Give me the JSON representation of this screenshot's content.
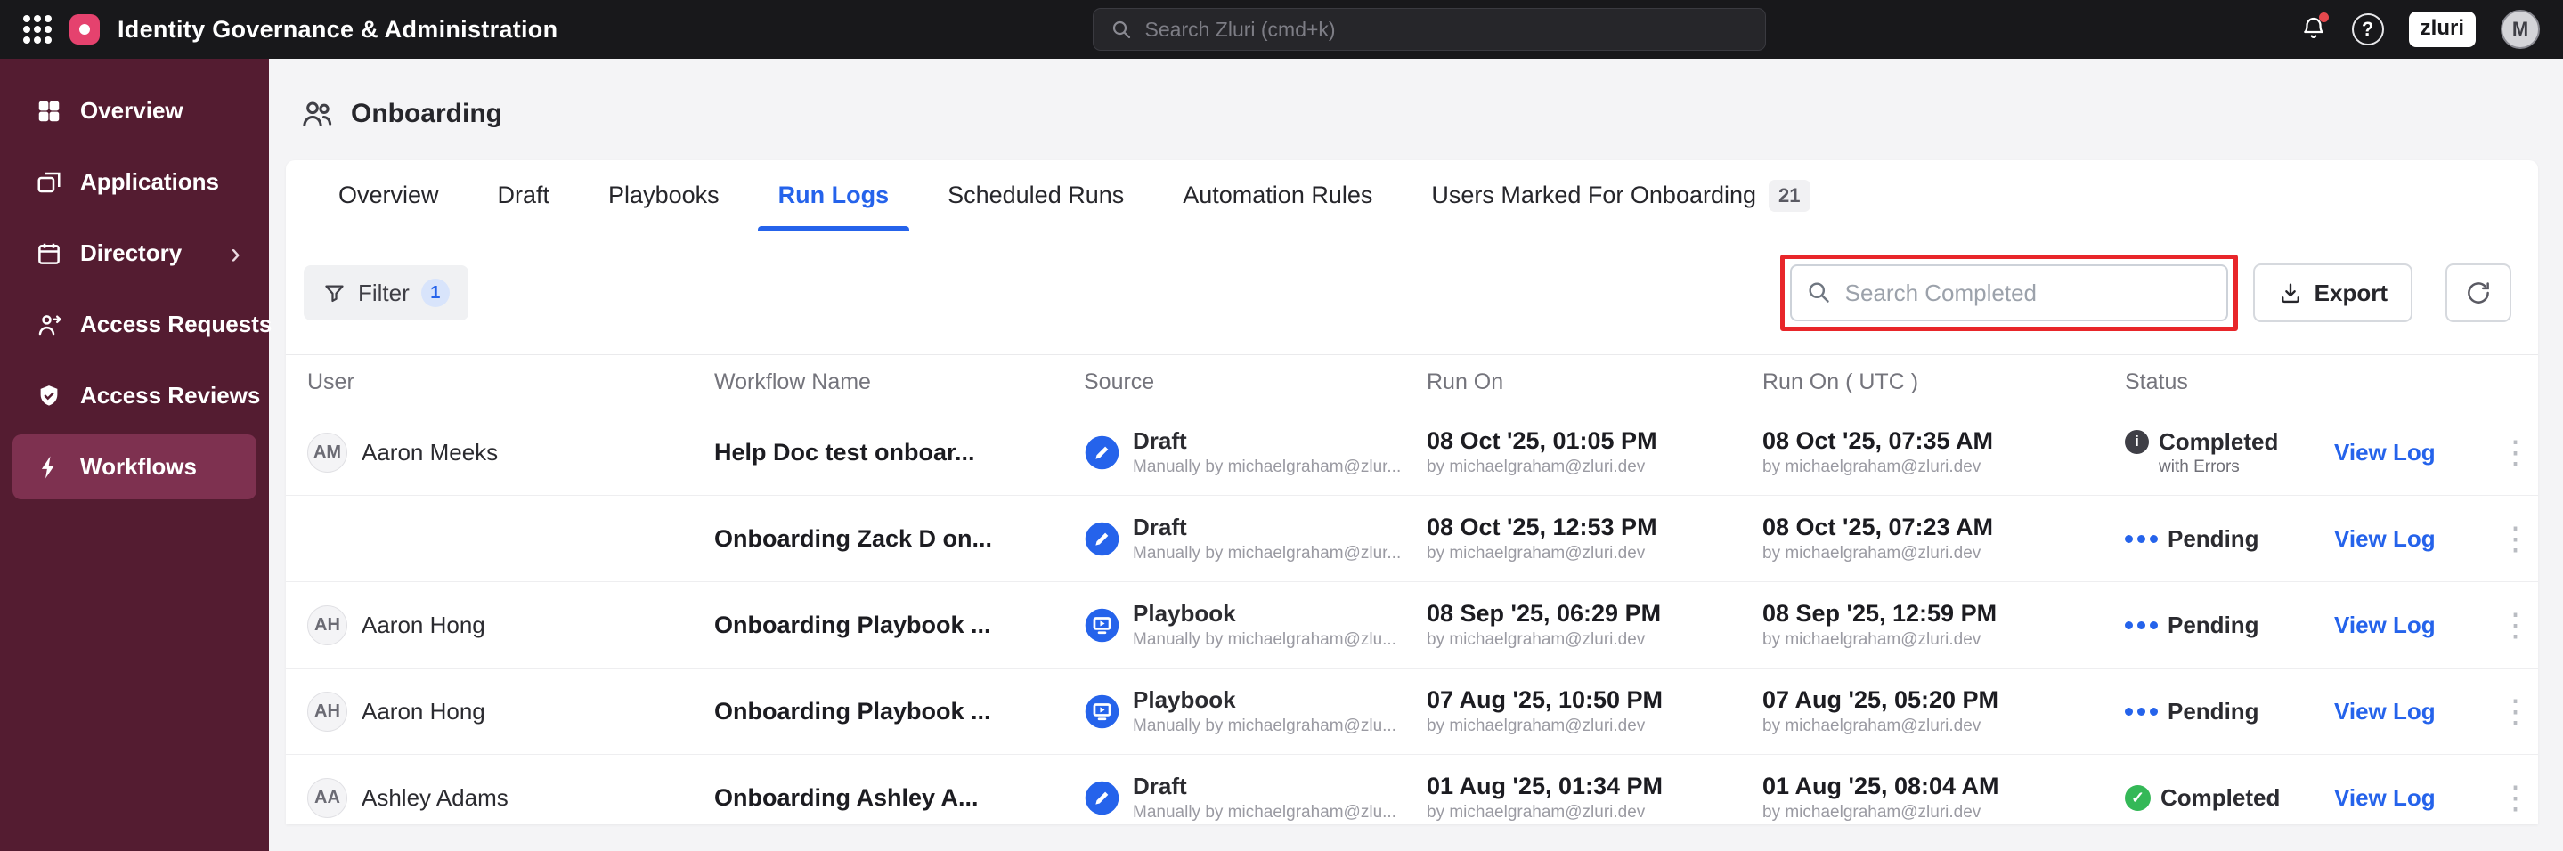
{
  "topbar": {
    "title": "Identity Governance & Administration",
    "search_placeholder": "Search Zluri (cmd+k)",
    "logo_text": "zluri",
    "avatar_initial": "M"
  },
  "sidebar": {
    "items": [
      {
        "label": "Overview"
      },
      {
        "label": "Applications"
      },
      {
        "label": "Directory"
      },
      {
        "label": "Access Requests"
      },
      {
        "label": "Access Reviews"
      },
      {
        "label": "Workflows"
      }
    ]
  },
  "page": {
    "title": "Onboarding",
    "tabs": [
      {
        "label": "Overview"
      },
      {
        "label": "Draft"
      },
      {
        "label": "Playbooks"
      },
      {
        "label": "Run Logs"
      },
      {
        "label": "Scheduled Runs"
      },
      {
        "label": "Automation Rules"
      },
      {
        "label": "Users Marked For Onboarding",
        "badge": "21"
      }
    ],
    "toolbar": {
      "filter_label": "Filter",
      "filter_badge": "1",
      "search_placeholder": "Search Completed",
      "export_label": "Export"
    }
  },
  "table": {
    "columns": [
      "User",
      "Workflow Name",
      "Source",
      "Run On",
      "Run On ( UTC )",
      "Status"
    ],
    "view_log_label": "View Log",
    "rows": [
      {
        "avatar": "AM",
        "user": "Aaron Meeks",
        "workflow": "Help Doc test onboar...",
        "source_type": "Draft",
        "source_sub": "Manually by michaelgraham@zlur...",
        "run_on": "08 Oct '25, 01:05 PM",
        "run_on_by": "by michaelgraham@zluri.dev",
        "run_on_utc": "08 Oct '25, 07:35 AM",
        "run_on_utc_by": "by michaelgraham@zluri.dev",
        "status": "Completed",
        "status_sub": "with Errors"
      },
      {
        "avatar": "",
        "user": "",
        "workflow": "Onboarding Zack D on...",
        "source_type": "Draft",
        "source_sub": "Manually by michaelgraham@zlur...",
        "run_on": "08 Oct '25, 12:53 PM",
        "run_on_by": "by michaelgraham@zluri.dev",
        "run_on_utc": "08 Oct '25, 07:23 AM",
        "run_on_utc_by": "by michaelgraham@zluri.dev",
        "status": "Pending"
      },
      {
        "avatar": "AH",
        "user": "Aaron Hong",
        "workflow": "Onboarding Playbook ...",
        "source_type": "Playbook",
        "source_sub": "Manually by michaelgraham@zlu...",
        "run_on": "08 Sep '25, 06:29 PM",
        "run_on_by": "by michaelgraham@zluri.dev",
        "run_on_utc": "08 Sep '25, 12:59 PM",
        "run_on_utc_by": "by michaelgraham@zluri.dev",
        "status": "Pending"
      },
      {
        "avatar": "AH",
        "user": "Aaron Hong",
        "workflow": "Onboarding Playbook ...",
        "source_type": "Playbook",
        "source_sub": "Manually by michaelgraham@zlu...",
        "run_on": "07 Aug '25, 10:50 PM",
        "run_on_by": "by michaelgraham@zluri.dev",
        "run_on_utc": "07 Aug '25, 05:20 PM",
        "run_on_utc_by": "by michaelgraham@zluri.dev",
        "status": "Pending"
      },
      {
        "avatar": "AA",
        "user": "Ashley Adams",
        "workflow": "Onboarding Ashley A...",
        "source_type": "Draft",
        "source_sub": "Manually by michaelgraham@zlu...",
        "run_on": "01 Aug '25, 01:34 PM",
        "run_on_by": "by michaelgraham@zluri.dev",
        "run_on_utc": "01 Aug '25, 08:04 AM",
        "run_on_utc_by": "by michaelgraham@zluri.dev",
        "status": "Completed"
      }
    ]
  },
  "colors": {
    "topbar_bg": "#18181B",
    "sidebar_bg": "#541C31",
    "sidebar_active": "#7E3150",
    "accent_blue": "#2563EB",
    "annotation_red": "#E8262A",
    "status_green": "#34B857"
  }
}
